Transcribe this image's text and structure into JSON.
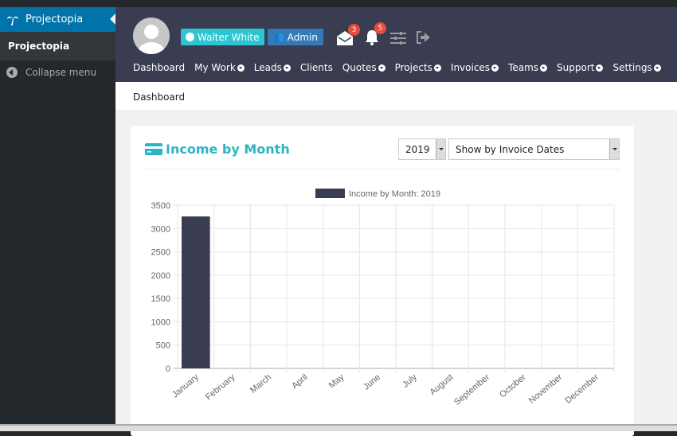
{
  "sidebar": {
    "app_label": "Projectopia",
    "sub_label": "Projectopia",
    "collapse_label": "Collapse menu"
  },
  "header": {
    "user_name": "Walter White",
    "role": "Admin",
    "messages_count": "3",
    "notifications_count": "5",
    "nav": [
      {
        "label": "Dashboard",
        "dropdown": false
      },
      {
        "label": "My Work",
        "dropdown": true
      },
      {
        "label": "Leads",
        "dropdown": true
      },
      {
        "label": "Clients",
        "dropdown": false
      },
      {
        "label": "Quotes",
        "dropdown": true
      },
      {
        "label": "Projects",
        "dropdown": true
      },
      {
        "label": "Invoices",
        "dropdown": true
      },
      {
        "label": "Teams",
        "dropdown": true
      },
      {
        "label": "Support",
        "dropdown": true
      },
      {
        "label": "Settings",
        "dropdown": true
      }
    ]
  },
  "breadcrumb": "Dashboard",
  "card": {
    "title": "Income by Month",
    "year_select": "2019",
    "mode_select": "Show by Invoice Dates"
  },
  "colors": {
    "accent": "#2bb5c4",
    "bar": "#3a3d52",
    "header": "#3a3d52",
    "sidebar_active": "#0073aa"
  },
  "chart_data": {
    "type": "bar",
    "categories": [
      "January",
      "February",
      "March",
      "April",
      "May",
      "June",
      "July",
      "August",
      "September",
      "October",
      "November",
      "December"
    ],
    "series": [
      {
        "name": "Income by Month: 2019",
        "values": [
          3260,
          0,
          0,
          0,
          0,
          0,
          0,
          0,
          0,
          0,
          0,
          0
        ]
      }
    ],
    "ylim": [
      0,
      3500
    ],
    "yticks": [
      0,
      500,
      1000,
      1500,
      2000,
      2500,
      3000,
      3500
    ],
    "grid": true,
    "legend": "top"
  }
}
